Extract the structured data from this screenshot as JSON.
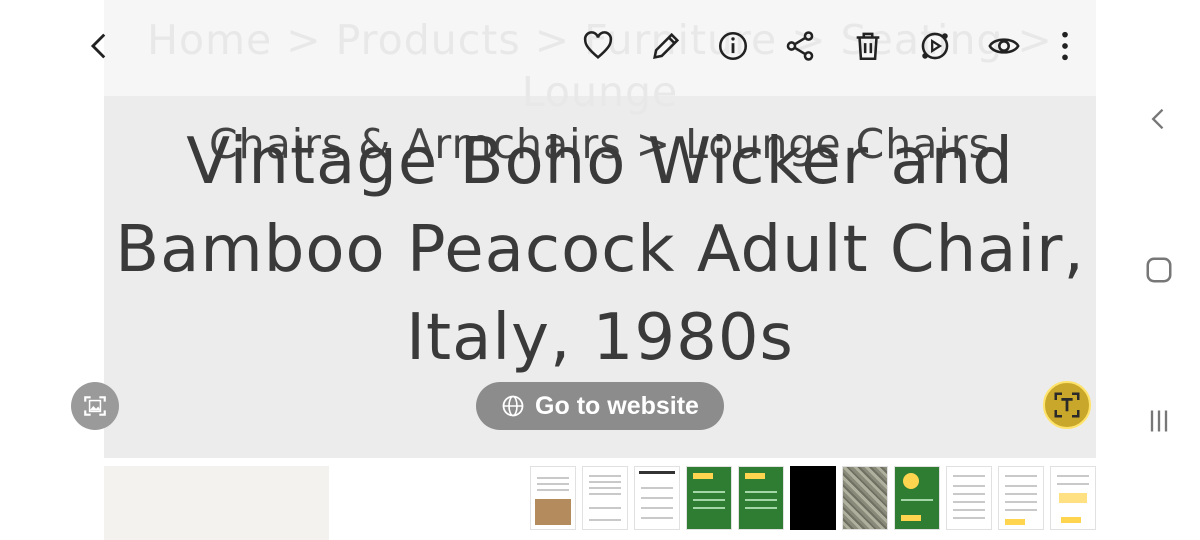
{
  "toolbar": {
    "back_icon": "back-arrow-icon",
    "icons": [
      "heart-icon",
      "edit-pencil-icon",
      "info-icon",
      "share-icon",
      "trash-icon",
      "remaster-icon",
      "eye-icon",
      "more-vertical-icon"
    ]
  },
  "image": {
    "breadcrumb_line1": "Home > Products > Furniture > Seating > Lounge",
    "breadcrumb_line2": "Chairs & Armchairs > Lounge Chairs",
    "title_line1": "Vintage Boho Wicker and",
    "title_line2": "Bamboo Peacock Adult Chair,",
    "title_line3": "Italy, 1980s"
  },
  "overlay": {
    "website_button_label": "Go to website"
  },
  "nav": {
    "icons": [
      "nav-back-icon",
      "nav-home-icon",
      "nav-recents-icon"
    ]
  },
  "colors": {
    "text_button_accent": "#c9a72a",
    "button_gray": "#8c8c8c"
  },
  "thumbnails": [
    "product-page",
    "product-specs",
    "document",
    "win-card",
    "win-card",
    "black",
    "gravel",
    "congratulations",
    "prize-list",
    "prize-list",
    "prize-amount"
  ]
}
